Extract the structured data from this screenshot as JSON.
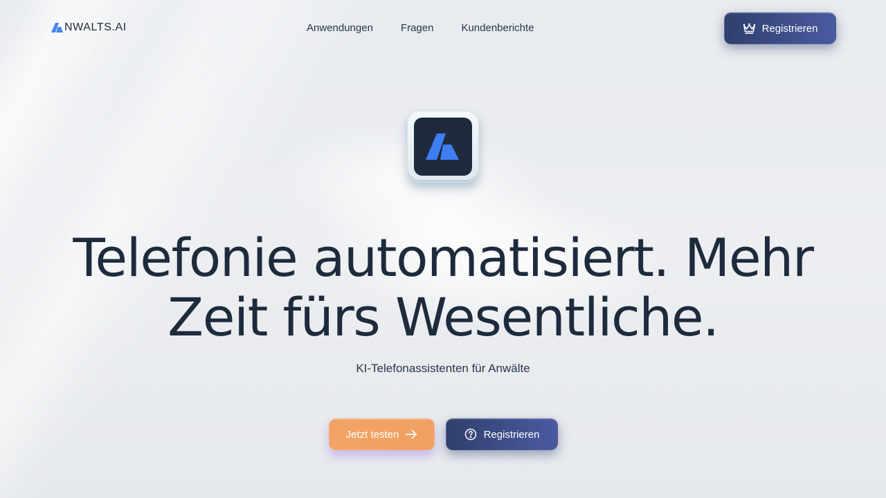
{
  "brand": {
    "logo_text": "NWALTS.AI",
    "logo_icon": "brand-a-mark",
    "accent_color": "#4a86f0"
  },
  "nav": {
    "items": [
      {
        "label": "Anwendungen"
      },
      {
        "label": "Fragen"
      },
      {
        "label": "Kundenberichte"
      }
    ]
  },
  "header": {
    "register_label": "Registrieren",
    "register_icon": "crown-icon"
  },
  "hero": {
    "app_icon": "brand-a-mark",
    "title_line1": "Telefonie automatisiert. Mehr",
    "title_line2": "Zeit fürs Wesentliche.",
    "subtitle": "KI-Telefonassistenten für Anwälte",
    "cta_primary_label": "Jetzt testen",
    "cta_primary_icon": "arrow-right-icon",
    "cta_secondary_label": "Registrieren",
    "cta_secondary_icon": "question-circle-icon"
  },
  "colors": {
    "text": "#1d2b3c",
    "primary_button": "#3a4a85",
    "cta_orange": "#f3a264",
    "background": "#e8ebef"
  }
}
